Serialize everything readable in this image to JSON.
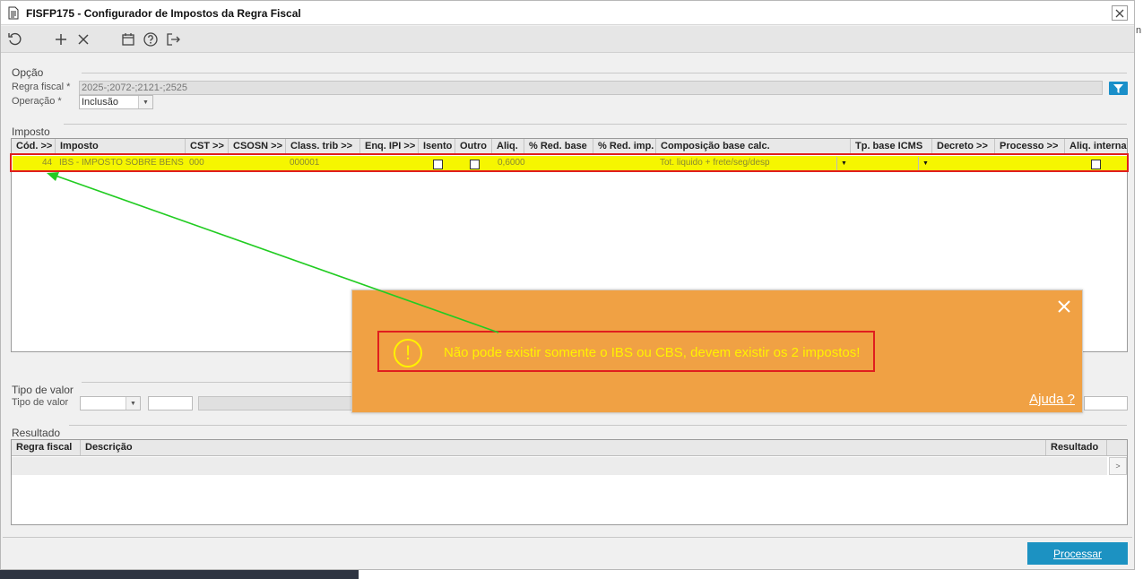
{
  "window": {
    "title": "FISFP175 - Configurador de Impostos da Regra Fiscal"
  },
  "toolbar": {
    "icons": [
      "refresh-icon",
      "add-icon",
      "delete-icon",
      "calendar-icon",
      "help-icon",
      "exit-icon"
    ]
  },
  "opcao": {
    "section_title": "Opção",
    "regra_label": "Regra fiscal *",
    "regra_value": "2025-;2072-;2121-;2525",
    "operacao_label": "Operação *",
    "operacao_value": "Inclusão"
  },
  "imposto": {
    "section_title": "Imposto",
    "columns": [
      "Cód. >>",
      "Imposto",
      "CST >>",
      "CSOSN >>",
      "Class. trib >>",
      "Enq. IPI >>",
      "Isento",
      "Outro",
      "Aliq.",
      "% Red. base",
      "% Red. imp.",
      "Composição base calc.",
      "Tp. base ICMS",
      "Decreto >>",
      "Processo >>",
      "Aliq. interna"
    ],
    "rows": [
      {
        "cod": "44",
        "imposto": "IBS - IMPOSTO SOBRE BENS",
        "cst": "000",
        "class_trib": "000001",
        "aliq": "0,6000",
        "composicao": "Tot. liquido + frete/seg/desp"
      }
    ]
  },
  "tipo_valor": {
    "section_title": "Tipo de valor",
    "label": "Tipo de valor"
  },
  "resultado": {
    "section_title": "Resultado",
    "columns": [
      "Regra fiscal",
      "Descrição",
      "Resultado"
    ],
    "scroll_glyph": ">"
  },
  "popup": {
    "message": "Não pode existir somente o IBS ou CBS, devem existir os 2 impostos!",
    "help_link": "Ajuda ?",
    "close_glyph": "×"
  },
  "actions": {
    "process_label": "Processar"
  },
  "side_fragment": "n",
  "colors": {
    "popup_bg": "#f0a144",
    "highlight_row": "#f6f600",
    "accent_blue": "#1c92c2",
    "annotation_red": "#e01e1e",
    "arrow_green": "#22cc22"
  }
}
